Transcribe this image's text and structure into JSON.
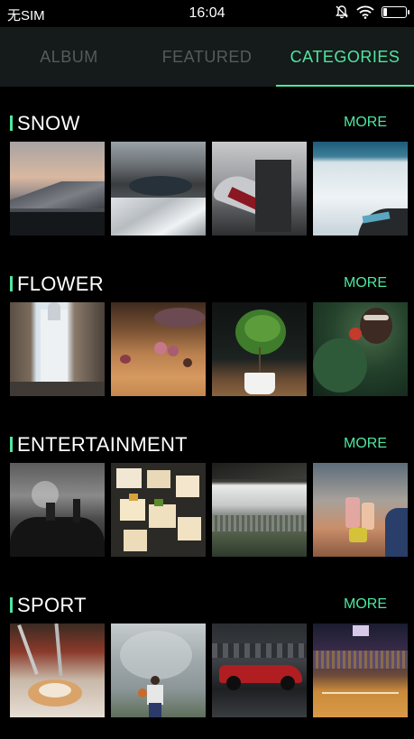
{
  "status_bar": {
    "carrier": "无SIM",
    "time": "16:04",
    "icons": [
      "mute-bell-icon",
      "wifi-icon",
      "battery-icon"
    ]
  },
  "tabs": [
    {
      "label": "ALBUM",
      "active": false
    },
    {
      "label": "FEATURED",
      "active": false
    },
    {
      "label": "CATEGORIES",
      "active": true
    }
  ],
  "colors": {
    "accent": "#4ee6a0",
    "tab_bar": "#151a1a",
    "inactive_tab": "#555b5b"
  },
  "sections": [
    {
      "title": "SNOW",
      "more": "MORE",
      "thumbs": [
        "snowy-mountain-sunset",
        "snowy-lake-valley",
        "ski-boot-close-up",
        "frozen-lake-shore"
      ]
    },
    {
      "title": "FLOWER",
      "more": "MORE",
      "thumbs": [
        "old-town-street-church",
        "dried-roses-on-table",
        "potted-plant-white-pot",
        "face-among-leaves"
      ]
    },
    {
      "title": "ENTERTAINMENT",
      "more": "MORE",
      "thumbs": [
        "concert-crowd-monochrome",
        "party-canapes-tray",
        "race-track-grandstand",
        "friends-toasting-drinks"
      ]
    },
    {
      "title": "SPORT",
      "more": "MORE",
      "thumbs": [
        "dessert-with-forks",
        "basketball-player-mural",
        "race-car-on-track",
        "basketball-arena-game"
      ]
    }
  ]
}
